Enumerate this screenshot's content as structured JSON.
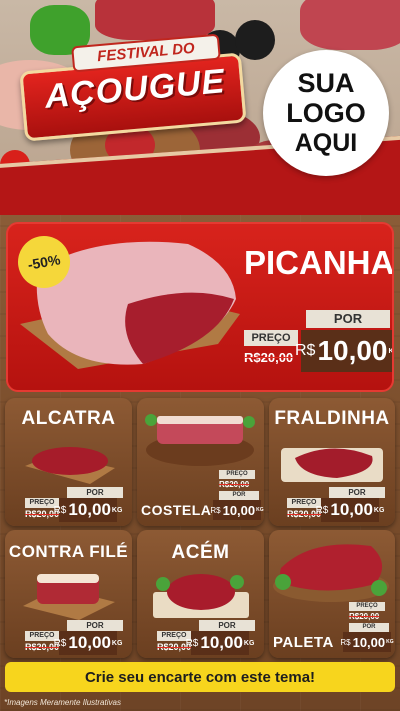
{
  "header": {
    "festival": "FESTIVAL DO",
    "title": "AÇOUGUE",
    "logo_lines": [
      "SUA",
      "LOGO",
      "AQUI"
    ]
  },
  "hero": {
    "badge": "-50%",
    "name": "PICANHA",
    "preco_label": "PREÇO",
    "old_price": "R$20,00",
    "por_label": "POR",
    "currency": "R$",
    "price": "10,00",
    "unit": "KG"
  },
  "products": [
    {
      "name": "ALCATRA",
      "preco_label": "PREÇO",
      "old_price": "R$20,00",
      "por_label": "POR",
      "currency": "R$",
      "price": "10,00",
      "unit": "KG"
    },
    {
      "name": "COSTELA",
      "preco_label": "PREÇO",
      "old_price": "R$20,00",
      "por_label": "POR",
      "currency": "R$",
      "price": "10,00",
      "unit": "KG"
    },
    {
      "name": "FRALDINHA",
      "preco_label": "PREÇO",
      "old_price": "R$20,00",
      "por_label": "POR",
      "currency": "R$",
      "price": "10,00",
      "unit": "KG"
    },
    {
      "name": "CONTRA FILÉ",
      "preco_label": "PREÇO",
      "old_price": "R$20,00",
      "por_label": "POR",
      "currency": "R$",
      "price": "10,00",
      "unit": "KG"
    },
    {
      "name": "ACÉM",
      "preco_label": "PREÇO",
      "old_price": "R$20,00",
      "por_label": "POR",
      "currency": "R$",
      "price": "10,00",
      "unit": "KG"
    },
    {
      "name": "PALETA",
      "preco_label": "PREÇO",
      "old_price": "R$20,00",
      "por_label": "POR",
      "currency": "R$",
      "price": "10,00",
      "unit": "KG"
    }
  ],
  "cta": "Crie seu encarte com este tema!",
  "disclaimer": "*Imagens Meramente Ilustrativas",
  "colors": {
    "red": "#d8231c",
    "yellow": "#f7d51d",
    "wood": "#8a5a36",
    "tag_dark": "#5a2f18"
  }
}
